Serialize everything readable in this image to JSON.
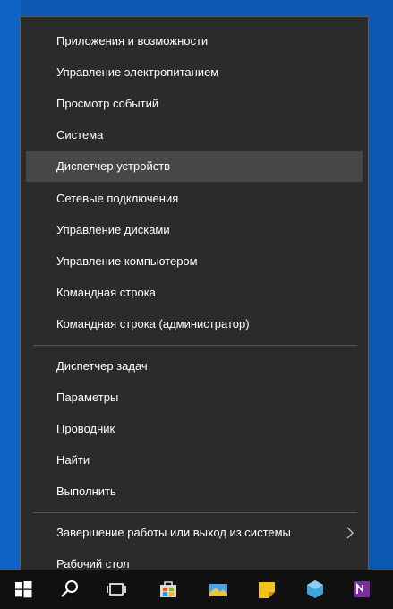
{
  "menu": {
    "items": [
      {
        "label": "Приложения и возможности"
      },
      {
        "label": "Управление электропитанием"
      },
      {
        "label": "Просмотр событий"
      },
      {
        "label": "Система"
      },
      {
        "label": "Диспетчер устройств"
      },
      {
        "label": "Сетевые подключения"
      },
      {
        "label": "Управление дисками"
      },
      {
        "label": "Управление компьютером"
      },
      {
        "label": "Командная строка"
      },
      {
        "label": "Командная строка (администратор)"
      },
      {
        "label": "Диспетчер задач"
      },
      {
        "label": "Параметры"
      },
      {
        "label": "Проводник"
      },
      {
        "label": "Найти"
      },
      {
        "label": "Выполнить"
      },
      {
        "label": "Завершение работы или выход из системы"
      },
      {
        "label": "Рабочий стол"
      }
    ],
    "highlighted_item": "Диспетчер устройств",
    "submenu_arrow_icon": "chevron-right-icon"
  },
  "taskbar": {
    "icons": [
      "windows-start-icon",
      "search-icon",
      "task-view-icon",
      "store-icon",
      "photos-icon",
      "sticky-notes-icon",
      "app-icon",
      "onenote-icon"
    ]
  },
  "colors": {
    "desktop": "#0c5ab4",
    "menu_background": "#2b2b2b",
    "menu_highlight": "#474747",
    "taskbar": "#101010",
    "text": "#ffffff"
  }
}
